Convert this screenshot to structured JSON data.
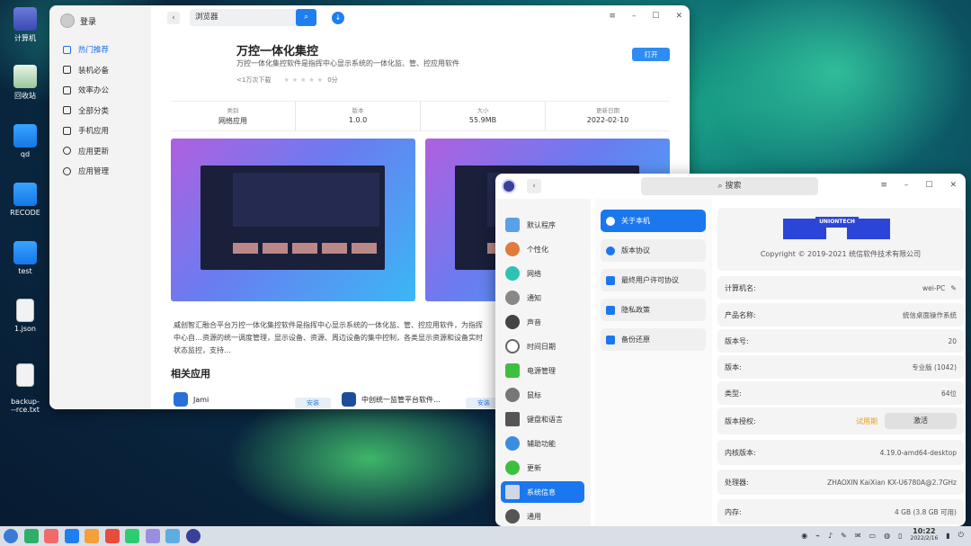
{
  "desktop": {
    "icons": [
      {
        "label": "计算机",
        "icon": "computer-icon"
      },
      {
        "label": "回收站",
        "icon": "trash-icon"
      },
      {
        "label": "qd",
        "icon": "folder-icon"
      },
      {
        "label": "RECODE",
        "icon": "folder-icon"
      },
      {
        "label": "test",
        "icon": "folder-icon"
      },
      {
        "label": "1.json",
        "icon": "file-icon"
      },
      {
        "label": "backup-\n--rce.txt",
        "icon": "file-icon"
      }
    ]
  },
  "store": {
    "login": "登录",
    "nav": [
      {
        "label": "热门推荐",
        "active": true
      },
      {
        "label": "装机必备"
      },
      {
        "label": "效率办公"
      },
      {
        "label": "全部分类"
      },
      {
        "label": "手机应用"
      },
      {
        "label": "应用更新"
      },
      {
        "label": "应用管理"
      }
    ],
    "search_value": "浏览器",
    "app": {
      "title": "万控一体化集控",
      "desc": "万控一体化集控软件是指挥中心显示系统的一体化监、管、控应用软件",
      "downloads": "<1万次下载",
      "rating": "0分",
      "open_label": "打开"
    },
    "info": [
      {
        "k": "类别",
        "v": "网络应用"
      },
      {
        "k": "版本",
        "v": "1.0.0"
      },
      {
        "k": "大小",
        "v": "55.9MB"
      },
      {
        "k": "更新日期",
        "v": "2022-02-10"
      }
    ],
    "long_desc": "威创智汇融合平台万控一体化集控软件是指挥中心显示系统的一体化监、管、控应用软件，为指挥中心自…资源的统一调度管理，显示设备、资源、周边设备的集中控制，各类显示资源和设备实时状态监控，支持…",
    "related_heading": "相关应用",
    "related": [
      {
        "name": "Jami",
        "install": "安装"
      },
      {
        "name": "中创统一监管平台软件…",
        "install": "安装"
      }
    ]
  },
  "cc": {
    "search_placeholder": "搜索",
    "nav": [
      {
        "label": "默认程序",
        "color": "#5aa0e8"
      },
      {
        "label": "个性化",
        "color": "#e07b39"
      },
      {
        "label": "网络",
        "color": "#2cc3b3"
      },
      {
        "label": "通知",
        "color": "#888888"
      },
      {
        "label": "声音",
        "color": "#444444"
      },
      {
        "label": "时间日期",
        "color": "#666666"
      },
      {
        "label": "电源管理",
        "color": "#3fbf3f"
      },
      {
        "label": "鼠标",
        "color": "#777777"
      },
      {
        "label": "键盘和语言",
        "color": "#555555"
      },
      {
        "label": "辅助功能",
        "color": "#3a8ee0"
      },
      {
        "label": "更新",
        "color": "#3fbf3f"
      },
      {
        "label": "系统信息",
        "color": "#7b8aa0",
        "active": true
      },
      {
        "label": "通用",
        "color": "#555555"
      }
    ],
    "sub": [
      {
        "label": "关于本机",
        "active": true
      },
      {
        "label": "版本协议"
      },
      {
        "label": "最终用户许可协议"
      },
      {
        "label": "隐私政策"
      },
      {
        "label": "备份还原"
      }
    ],
    "brand": "UNIONTECH",
    "copyright": "Copyright © 2019-2021 统信软件技术有限公司",
    "info": [
      {
        "k": "计算机名:",
        "v": "wei-PC"
      },
      {
        "k": "产品名称:",
        "v": "统信桌面操作系统"
      },
      {
        "k": "版本号:",
        "v": "20"
      },
      {
        "k": "版本:",
        "v": "专业版 (1042)"
      },
      {
        "k": "类型:",
        "v": "64位"
      },
      {
        "k": "版本授权:",
        "v": "试用期",
        "button": "激活"
      },
      {
        "k": "内核版本:",
        "v": "4.19.0-amd64-desktop"
      },
      {
        "k": "处理器:",
        "v": "ZHAOXIN KaiXian KX-U6780A@2.7GHz"
      },
      {
        "k": "内存:",
        "v": "4 GB (3.8 GB 可用)"
      }
    ]
  },
  "taskbar": {
    "time": "10:22",
    "date": "2022/2/16"
  }
}
